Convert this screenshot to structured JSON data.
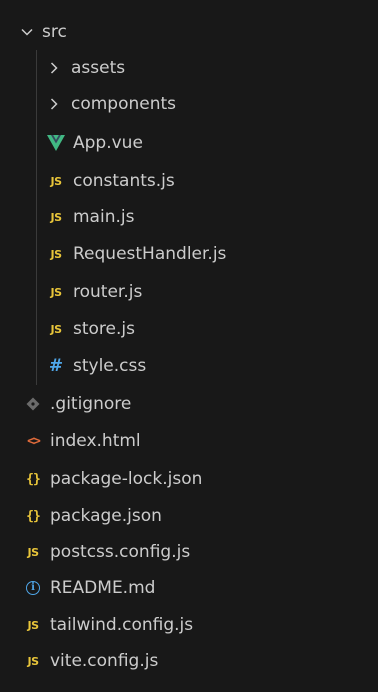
{
  "explorer": {
    "root_folder": {
      "label": "src",
      "expanded": true,
      "icon": "chevron-down-icon"
    },
    "src_children": {
      "assets": {
        "label": "assets",
        "icon": "chevron-right-icon"
      },
      "components": {
        "label": "components",
        "icon": "chevron-right-icon"
      },
      "app_vue": {
        "label": "App.vue",
        "icon": "vue-icon",
        "icon_color": "#41b883"
      },
      "constants_js": {
        "label": "constants.js",
        "icon": "js-icon",
        "icon_text": "JS"
      },
      "main_js": {
        "label": "main.js",
        "icon": "js-icon",
        "icon_text": "JS"
      },
      "request_handler_js": {
        "label": "RequestHandler.js",
        "icon": "js-icon",
        "icon_text": "JS"
      },
      "router_js": {
        "label": "router.js",
        "icon": "js-icon",
        "icon_text": "JS"
      },
      "store_js": {
        "label": "store.js",
        "icon": "js-icon",
        "icon_text": "JS"
      },
      "style_css": {
        "label": "style.css",
        "icon": "css-hash-icon",
        "icon_text": "#"
      }
    },
    "root_files": {
      "gitignore": {
        "label": ".gitignore",
        "icon": "git-diamond-icon"
      },
      "index_html": {
        "label": "index.html",
        "icon": "html-icon",
        "icon_text": "<>"
      },
      "package_lock_json": {
        "label": "package-lock.json",
        "icon": "json-icon",
        "icon_text": "{}"
      },
      "package_json": {
        "label": "package.json",
        "icon": "json-icon",
        "icon_text": "{}"
      },
      "postcss_config_js": {
        "label": "postcss.config.js",
        "icon": "js-icon",
        "icon_text": "JS"
      },
      "readme_md": {
        "label": "README.md",
        "icon": "info-icon",
        "icon_text": "i"
      },
      "tailwind_config_js": {
        "label": "tailwind.config.js",
        "icon": "js-icon",
        "icon_text": "JS"
      },
      "vite_config_js": {
        "label": "vite.config.js",
        "icon": "js-icon",
        "icon_text": "JS"
      }
    }
  },
  "colors": {
    "background": "#181818",
    "text": "#cccccc",
    "js": "#e8c53a",
    "css": "#4fa6e8",
    "html": "#e06b3b",
    "vue": "#41b883",
    "git": "#6b6b6b",
    "info": "#4fa6e8",
    "indent_guide": "#3a3a3a"
  }
}
